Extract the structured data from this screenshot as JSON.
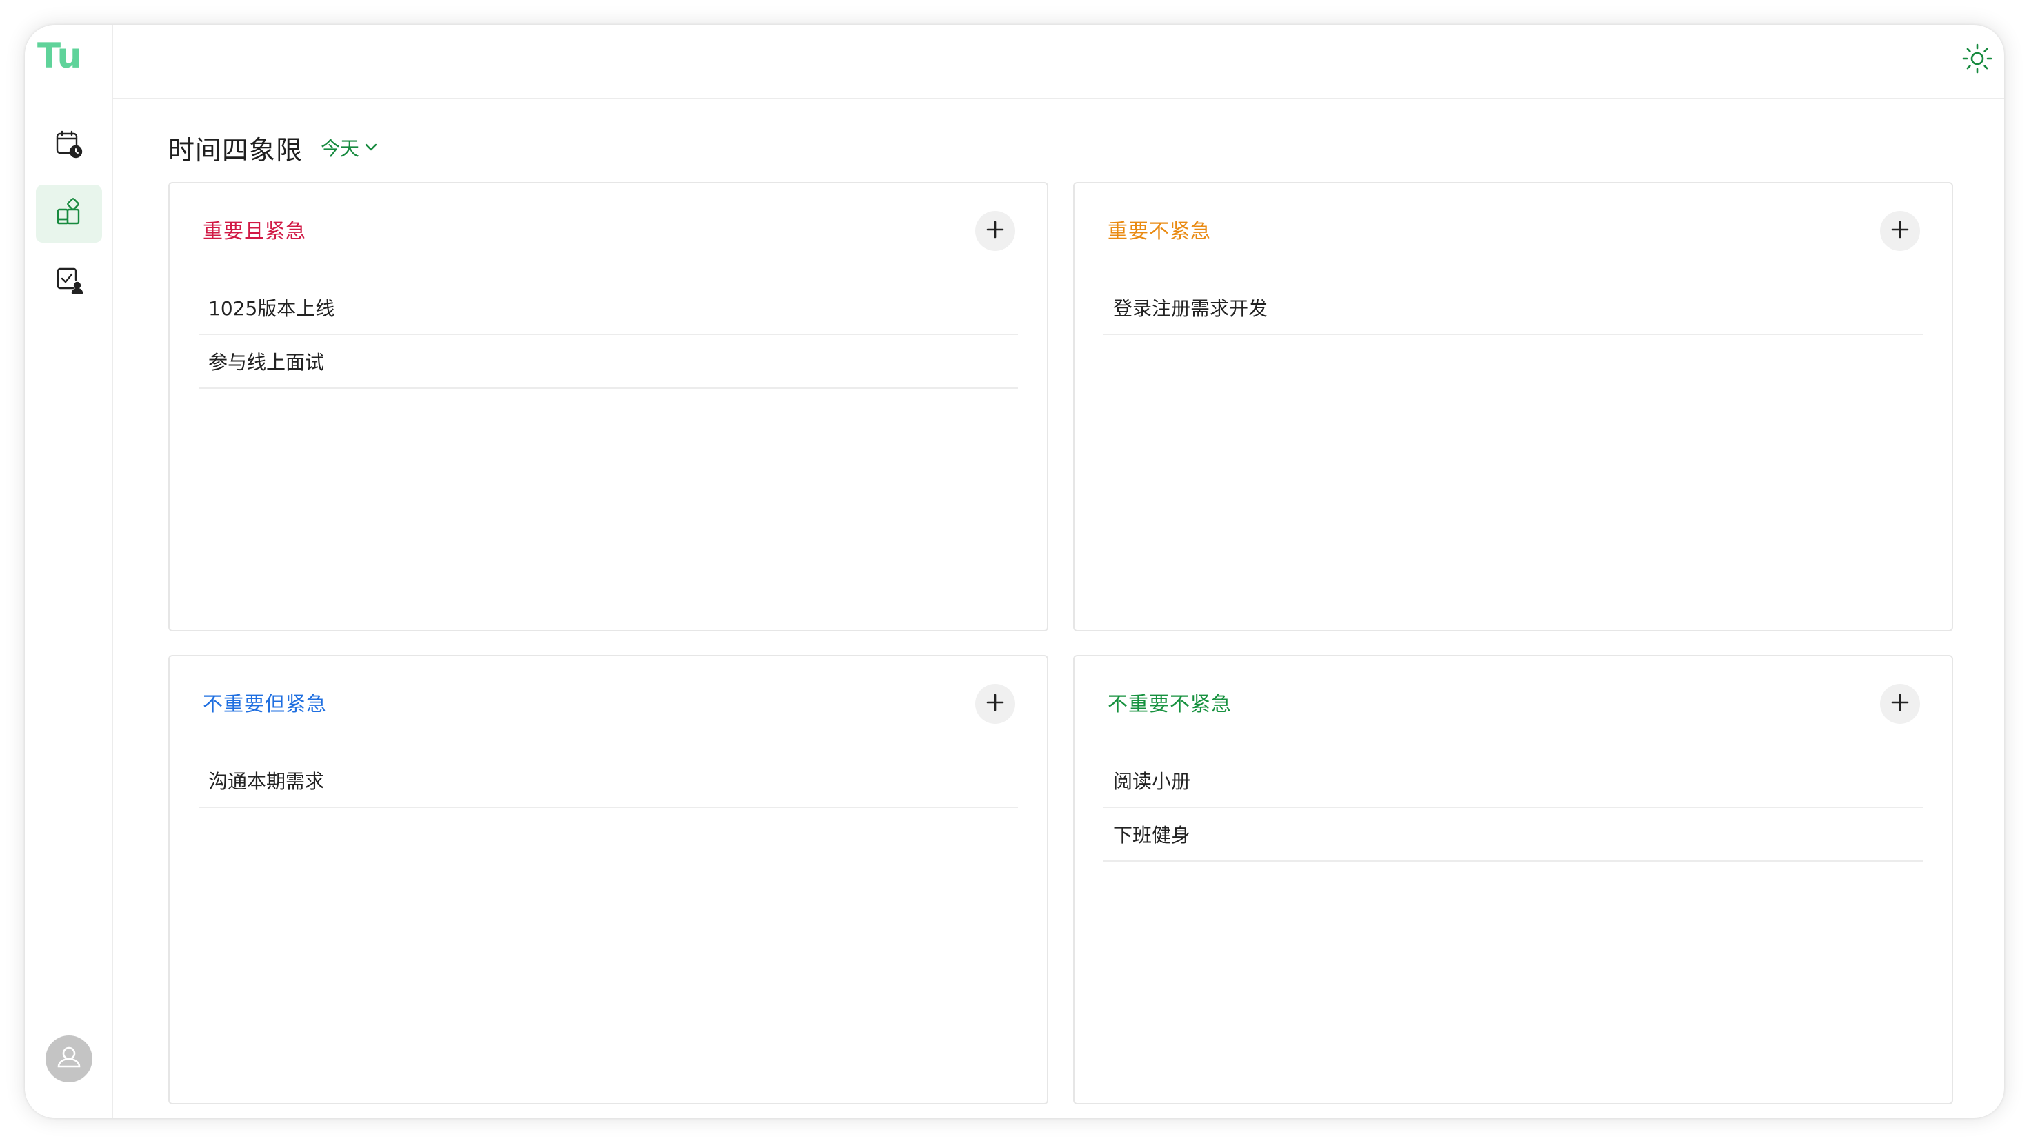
{
  "app": {
    "logo_text": "Tu",
    "brand_color": "#5fd39a"
  },
  "sidebar": {
    "items": [
      {
        "icon": "calendar-clock-icon",
        "active": false
      },
      {
        "icon": "grid-quadrant-icon",
        "active": true
      },
      {
        "icon": "task-check-user-icon",
        "active": false
      }
    ],
    "avatar_icon": "user-avatar-icon"
  },
  "header": {
    "theme_icon": "sun-icon"
  },
  "page": {
    "title": "时间四象限",
    "period": "今天"
  },
  "quadrants": [
    {
      "title": "重要且紧急",
      "color": "#d11a45",
      "tasks": [
        "1025版本上线",
        "参与线上面试"
      ]
    },
    {
      "title": "重要不紧急",
      "color": "#e98a12",
      "tasks": [
        "登录注册需求开发"
      ]
    },
    {
      "title": "不重要但紧急",
      "color": "#1f6fe0",
      "tasks": [
        "沟通本期需求"
      ]
    },
    {
      "title": "不重要不紧急",
      "color": "#16913e",
      "tasks": [
        "阅读小册",
        "下班健身"
      ]
    }
  ],
  "colors": {
    "accent": "#178a3f",
    "active_nav_bg": "#e8f5ec"
  }
}
